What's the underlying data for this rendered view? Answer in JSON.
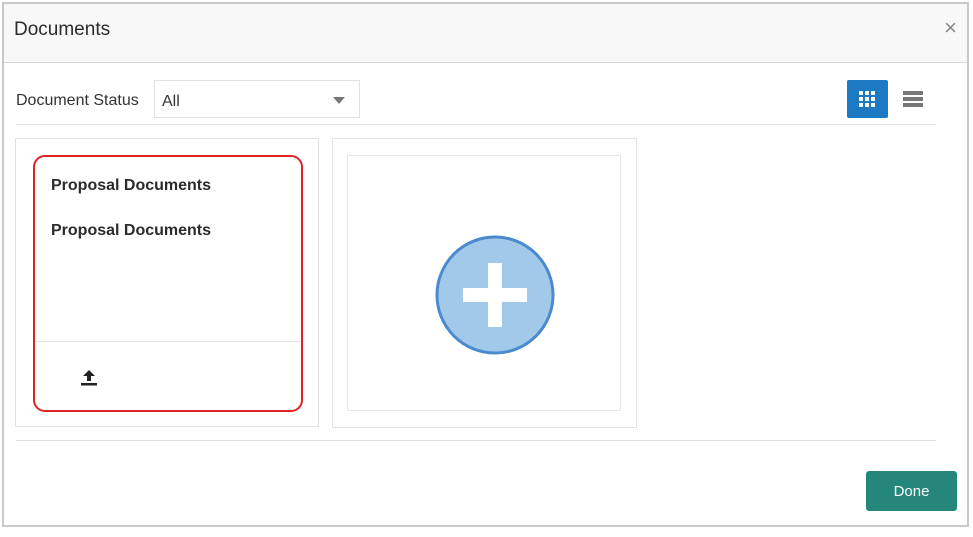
{
  "dialog": {
    "title": "Documents",
    "close_glyph": "×"
  },
  "filter": {
    "label": "Document Status",
    "selected": "All"
  },
  "view_toggle": {
    "grid_icon": "grid-view-icon",
    "list_icon": "list-view-icon",
    "active": "grid",
    "active_color": "#1c7ac2"
  },
  "document_card": {
    "name": "Proposal Documents",
    "description": "Proposal Documents",
    "upload_icon": "upload-icon",
    "highlight_color": "#e02424"
  },
  "add_card": {
    "icon": "add-plus-icon",
    "circle_color": "#a3c9ea",
    "circle_border": "#4a8bcf"
  },
  "footer": {
    "done_label": "Done",
    "done_color": "#25877b"
  }
}
